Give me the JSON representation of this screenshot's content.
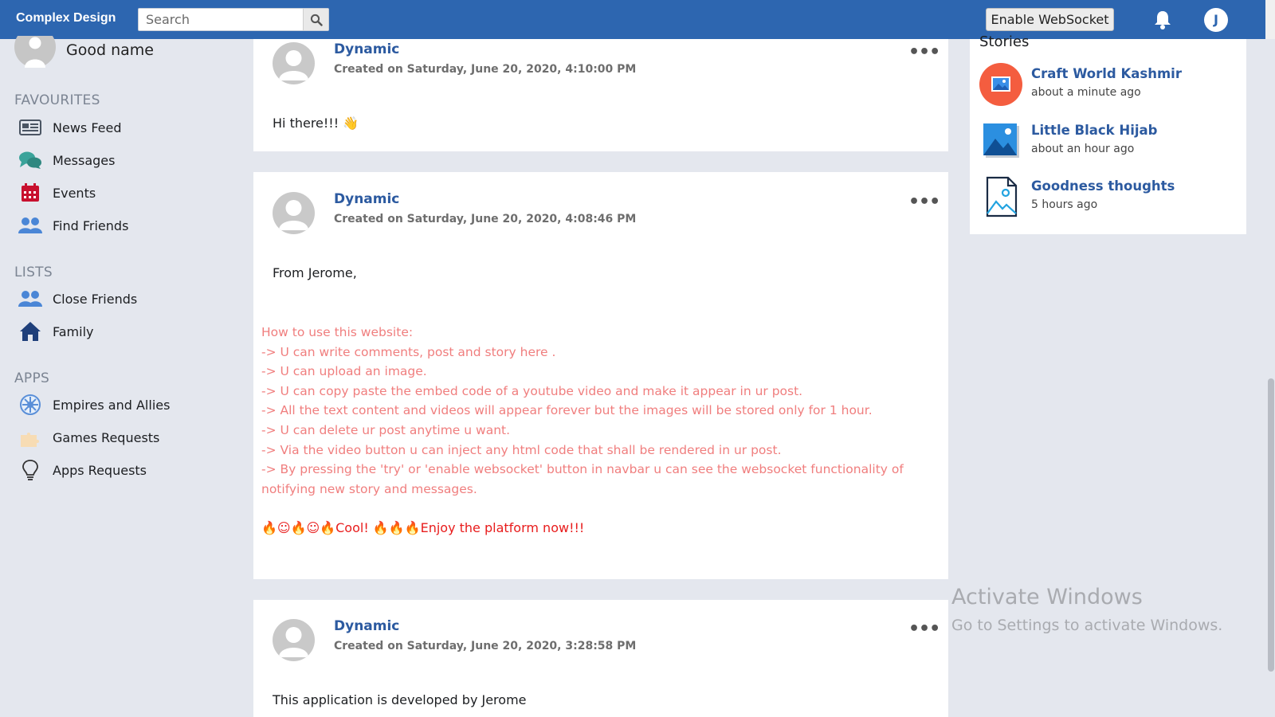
{
  "navbar": {
    "brand": "Complex Design",
    "search_placeholder": "Search",
    "websocket_label": "Enable WebSocket",
    "avatar_initial": "J"
  },
  "sidebar": {
    "profile_name": "Good name",
    "sections": [
      {
        "title": "FAVOURITES",
        "items": [
          {
            "label": "News Feed",
            "icon": "newspaper-icon"
          },
          {
            "label": "Messages",
            "icon": "chat-bubbles-icon"
          },
          {
            "label": "Events",
            "icon": "calendar-icon"
          },
          {
            "label": "Find Friends",
            "icon": "users-icon"
          }
        ]
      },
      {
        "title": "LISTS",
        "items": [
          {
            "label": "Close Friends",
            "icon": "users-icon"
          },
          {
            "label": "Family",
            "icon": "home-icon"
          }
        ]
      },
      {
        "title": "APPS",
        "items": [
          {
            "label": "Empires and Allies",
            "icon": "empire-icon"
          },
          {
            "label": "Games Requests",
            "icon": "puzzle-icon"
          },
          {
            "label": "Apps Requests",
            "icon": "lightbulb-icon"
          }
        ]
      }
    ]
  },
  "posts": [
    {
      "author": "Dynamic",
      "date": "Created on Saturday, June 20, 2020, 4:10:00 PM",
      "text": "Hi there!!! "
    },
    {
      "author": "Dynamic",
      "date": "Created on Saturday, June 20, 2020, 4:08:46 PM",
      "text": "From Jerome,",
      "howto": [
        "How to use this website:",
        "-> U can write comments, post and story here .",
        "-> U can upload an image.",
        "-> U can copy paste the embed code of a youtube video and make it appear in ur post.",
        "-> All the text content and videos will appear forever but the images will be stored only for 1 hour.",
        "-> U can delete ur post anytime u want.",
        "-> Via the video button u can inject any html code that shall be rendered in ur post.",
        "-> By pressing the 'try' or 'enable websocket' button in navbar u can see the websocket functionality of notifying new story and messages."
      ],
      "cool_1": "Cool! ",
      "cool_2": "Enjoy the platform now!!!"
    },
    {
      "author": "Dynamic",
      "date": "Created on Saturday, June 20, 2020, 3:28:58 PM",
      "text": "This application is developed by Jerome"
    }
  ],
  "stories": {
    "title": "Stories",
    "items": [
      {
        "name": "Craft World Kashmir",
        "time": "about a minute ago"
      },
      {
        "name": "Little Black Hijab",
        "time": "about an hour ago"
      },
      {
        "name": "Goodness thoughts",
        "time": "5 hours ago"
      }
    ]
  },
  "watermark": {
    "line1": "Activate Windows",
    "line2": "Go to Settings to activate Windows."
  },
  "colors": {
    "navbar": "#2d66b0",
    "author_link": "#2c5aa0",
    "howto_text": "#f07e7e",
    "cool_text": "#e81c1c"
  }
}
